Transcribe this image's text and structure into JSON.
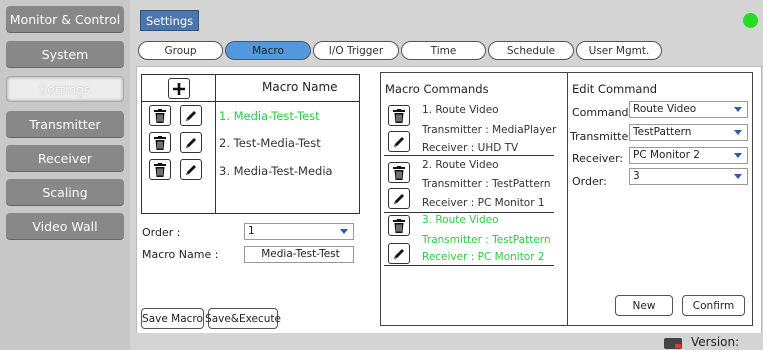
{
  "sidebar": {
    "items": [
      {
        "label": "Monitor & Control"
      },
      {
        "label": "System"
      },
      {
        "label": "Settings"
      },
      {
        "label": "Transmitter"
      },
      {
        "label": "Receiver"
      },
      {
        "label": "Scaling"
      },
      {
        "label": "Video Wall"
      }
    ]
  },
  "header": {
    "title": "Settings",
    "status_color": "#22dd22"
  },
  "tabs": [
    {
      "label": "Group"
    },
    {
      "label": "Macro"
    },
    {
      "label": "I/O Trigger"
    },
    {
      "label": "Time"
    },
    {
      "label": "Schedule"
    },
    {
      "label": "User Mgmt."
    }
  ],
  "macro_table": {
    "add_icon": "plus-icon",
    "header": "Macro Name",
    "items": [
      {
        "name": "1. Media-Test-Test"
      },
      {
        "name": "2. Test-Media-Test"
      },
      {
        "name": "3. Media-Test-Media"
      }
    ]
  },
  "macro_form": {
    "order_label": "Order :",
    "order_value": "1",
    "name_label": "Macro Name :",
    "name_value": "Media-Test-Test",
    "save_label": "Save Macro",
    "save_execute_label": "Save&Execute"
  },
  "macro_commands": {
    "title": "Macro Commands",
    "commands": [
      {
        "line1": "1. Route Video",
        "line2": "Transmitter : MediaPlayer",
        "line3": "Receiver : UHD TV"
      },
      {
        "line1": "2. Route Video",
        "line2": "Transmitter : TestPattern",
        "line3": "Receiver : PC Monitor 1"
      },
      {
        "line1": "3. Route Video",
        "line2": "Transmitter : TestPattern",
        "line3": "Receiver : PC Monitor 2"
      }
    ]
  },
  "edit_command": {
    "title": "Edit Command",
    "command_label": "Command:",
    "command_value": "Route Video",
    "transmitter_label": "Transmitter:",
    "transmitter_value": "TestPattern",
    "receiver_label": "Receiver:",
    "receiver_value": "PC Monitor 2",
    "order_label": "Order:",
    "order_value": "3",
    "new_label": "New",
    "confirm_label": "Confirm"
  },
  "footer": {
    "version_label": "Version:"
  },
  "colors": {
    "accent": "#4a76ad",
    "active_tab": "#5599dd",
    "selected_text": "#2ecc40"
  }
}
